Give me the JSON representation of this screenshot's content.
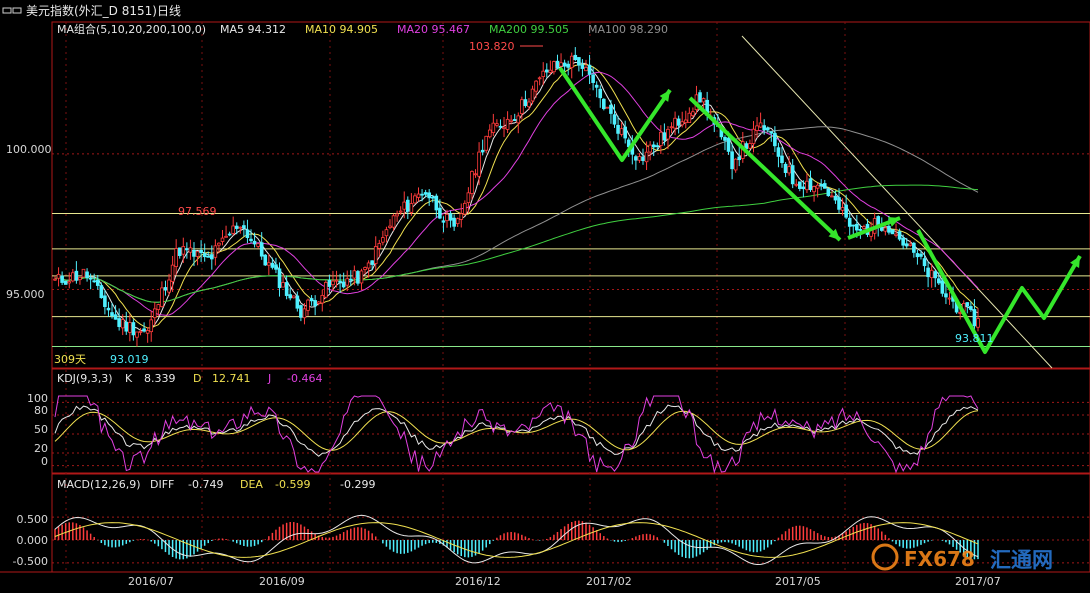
{
  "window": {
    "title": "美元指数(外汇_D 8151)日线",
    "title_icon": "window-icon"
  },
  "ma_legend": {
    "label": "MA组合(5,10,20,200,100,0)",
    "items": [
      {
        "text": "MA5 94.312",
        "color": "#e8e8e8"
      },
      {
        "text": "MA10 94.905",
        "color": "#f0e050"
      },
      {
        "text": "MA20 95.467",
        "color": "#e040e0"
      },
      {
        "text": "MA200 99.505",
        "color": "#40d040"
      },
      {
        "text": "MA100 98.290",
        "color": "#909090"
      }
    ]
  },
  "kdj_legend": {
    "label": "KDJ(9,3,3)",
    "k_label": "K",
    "k_value": "8.339",
    "d_label": "D",
    "d_value": "12.741",
    "j_label": "J",
    "j_value": "-0.464"
  },
  "macd_legend": {
    "label": "MACD(12,26,9)",
    "diff_label": "DIFF",
    "diff_value": "-0.749",
    "dea_label": "DEA",
    "dea_value": "-0.599",
    "macd_value": "-0.299"
  },
  "annotations": {
    "high": "103.820",
    "peak": "97.569",
    "low": "93.019",
    "last": "93.811",
    "days": "309天"
  },
  "axes": {
    "price_ticks": [
      "100.000",
      "95.000"
    ],
    "kdj_ticks": [
      "100",
      "80",
      "50",
      "20",
      "0"
    ],
    "macd_ticks": [
      "0.500",
      "0.000",
      "-0.500"
    ],
    "date_ticks": [
      "2016/07",
      "2016/09",
      "2016/12",
      "2017/02",
      "2017/05",
      "2017/07"
    ]
  },
  "watermark": {
    "brand": "FX678",
    "cn": "汇通网"
  },
  "colors": {
    "up": "#ff3c3c",
    "down": "#4ff0ff",
    "frame": "#b01818",
    "axis_text": "#d8d8d8",
    "hline": "#e8e890",
    "arrow": "#35e62b",
    "trend": "#e6e6b0"
  },
  "chart_data": {
    "type": "candlestick",
    "title": "美元指数(外汇_D 8151)日线",
    "x_ticks": [
      "2016/07",
      "2016/09",
      "2016/12",
      "2017/02",
      "2017/05",
      "2017/07"
    ],
    "ylim": [
      92.4,
      104.2
    ],
    "y_ticks": [
      95,
      100
    ],
    "anchors": [
      {
        "label": "2016/05",
        "value": 95.3
      },
      {
        "label": "2016/05",
        "value": 95.6
      },
      {
        "label": "2016/06",
        "value": 93.8
      },
      {
        "label": "2016/06",
        "value": 93.4
      },
      {
        "label": "2016/06",
        "value": 96.5
      },
      {
        "label": "2016/07",
        "value": 96.1
      },
      {
        "label": "2016/07",
        "value": 97.5
      },
      {
        "label": "2016/08",
        "value": 95.8
      },
      {
        "label": "2016/08",
        "value": 94.2
      },
      {
        "label": "2016/09",
        "value": 95.2
      },
      {
        "label": "2016/09",
        "value": 95.5
      },
      {
        "label": "2016/10",
        "value": 97.6
      },
      {
        "label": "2016/10",
        "value": 98.7
      },
      {
        "label": "2016/11",
        "value": 97.1
      },
      {
        "label": "2016/11",
        "value": 100.7
      },
      {
        "label": "2016/12",
        "value": 101.5
      },
      {
        "label": "2016/12",
        "value": 103.1
      },
      {
        "label": "2017/01",
        "value": 103.5
      },
      {
        "label": "2017/01",
        "value": 101.5
      },
      {
        "label": "2017/02",
        "value": 99.8
      },
      {
        "label": "2017/02",
        "value": 100.9
      },
      {
        "label": "2017/03",
        "value": 102.1
      },
      {
        "label": "2017/03",
        "value": 99.7
      },
      {
        "label": "2017/04",
        "value": 101.1
      },
      {
        "label": "2017/04",
        "value": 99.0
      },
      {
        "label": "2017/05",
        "value": 98.8
      },
      {
        "label": "2017/05",
        "value": 97.1
      },
      {
        "label": "2017/06",
        "value": 97.5
      },
      {
        "label": "2017/06",
        "value": 96.2
      },
      {
        "label": "2017/07",
        "value": 94.7
      },
      {
        "label": "2017/07",
        "value": 93.8
      }
    ],
    "high": 103.82,
    "local_high": 97.569,
    "low": 93.019,
    "last": 93.811,
    "horizontal_levels": [
      97.8,
      96.5,
      95.5,
      94.0,
      92.9
    ],
    "indicators": {
      "MA5": 94.312,
      "MA10": 94.905,
      "MA20": 95.467,
      "MA200": 99.505,
      "MA100": 98.29,
      "K": 8.339,
      "D": 12.741,
      "J": -0.464,
      "DIFF": -0.749,
      "DEA": -0.599,
      "MACD": -0.299
    },
    "kdj_ylim": [
      -10,
      110
    ],
    "macd_ylim": [
      -0.7,
      0.7
    ]
  }
}
